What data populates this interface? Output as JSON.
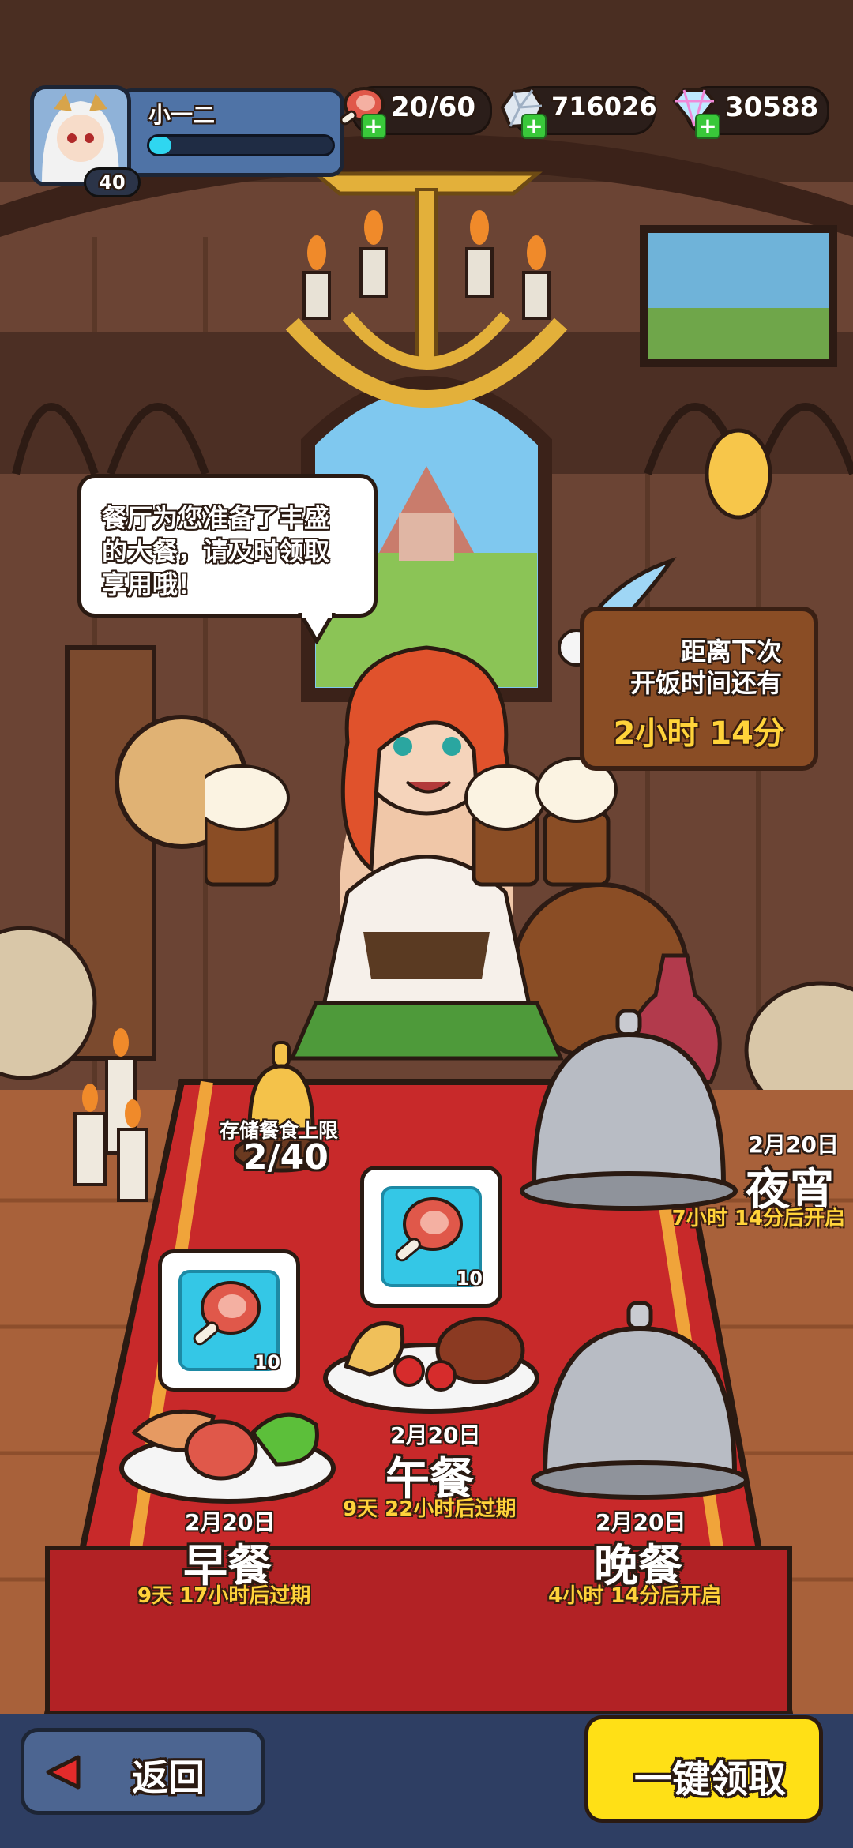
{
  "player": {
    "name": "小一二",
    "level": "40",
    "exp_fraction": 0.12
  },
  "resources": [
    {
      "icon": "meat-drumstick-icon",
      "value": "20/60"
    },
    {
      "icon": "silver-ore-icon",
      "value": "716026"
    },
    {
      "icon": "diamond-gem-icon",
      "value": "30588"
    }
  ],
  "speech": {
    "text": "餐厅为您准备了丰盛的大餐，请及时领取享用哦！"
  },
  "timer_sign": {
    "line1": "距离下次",
    "line2": "开饭时间还有",
    "time": "2小时 14分"
  },
  "storage": {
    "label": "存储餐食上限",
    "value": "2/40"
  },
  "meals": {
    "breakfast": {
      "date": "2月20日",
      "name": "早餐",
      "status": "9天 17小时后过期",
      "reward_count": "10"
    },
    "lunch": {
      "date": "2月20日",
      "name": "午餐",
      "status": "9天 22小时后过期",
      "reward_count": "10"
    },
    "dinner": {
      "date": "2月20日",
      "name": "晚餐",
      "status": "4小时 14分后开启"
    },
    "supper": {
      "date": "2月20日",
      "name": "夜宵",
      "status": "7小时 14分后开启"
    }
  },
  "buttons": {
    "back": "返回",
    "claim_all": "一键领取"
  },
  "colors": {
    "accent_yellow": "#ffe016",
    "table_red": "#c8292a",
    "exp_cyan": "#2fd6f0",
    "plus_green": "#39c83a"
  }
}
